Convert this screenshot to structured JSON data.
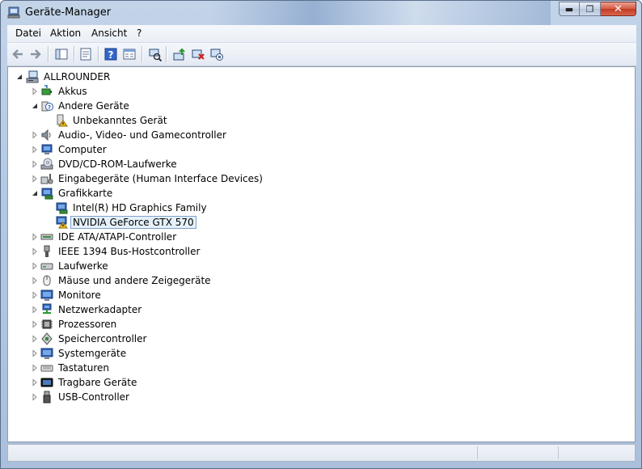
{
  "window": {
    "title": "Geräte-Manager"
  },
  "menu": [
    "Datei",
    "Aktion",
    "Ansicht",
    "?"
  ],
  "toolbar": [
    "back-icon",
    "forward-icon",
    "show-hide-tree-icon",
    "properties-icon",
    "help-icon",
    "view-icon",
    "scan-hardware-icon",
    "update-driver-icon",
    "uninstall-icon",
    "disable-icon"
  ],
  "tree": {
    "root": "ALLROUNDER",
    "items": [
      {
        "label": "Akkus",
        "icon": "battery-icon",
        "expanded": false
      },
      {
        "label": "Andere Geräte",
        "icon": "other-devices-icon",
        "expanded": true,
        "children": [
          {
            "label": "Unbekanntes Gerät",
            "icon": "unknown-device-warning-icon"
          }
        ]
      },
      {
        "label": "Audio-, Video- und Gamecontroller",
        "icon": "speaker-icon",
        "expanded": false
      },
      {
        "label": "Computer",
        "icon": "computer-icon",
        "expanded": false
      },
      {
        "label": "DVD/CD-ROM-Laufwerke",
        "icon": "dvd-drive-icon",
        "expanded": false
      },
      {
        "label": "Eingabegeräte (Human Interface Devices)",
        "icon": "hid-icon",
        "expanded": false
      },
      {
        "label": "Grafikkarte",
        "icon": "display-adapter-icon",
        "expanded": true,
        "children": [
          {
            "label": "Intel(R)  HD Graphics Family",
            "icon": "display-adapter-icon"
          },
          {
            "label": "NVIDIA GeForce GTX 570",
            "icon": "display-adapter-warning-icon",
            "selected": true
          }
        ]
      },
      {
        "label": "IDE ATA/ATAPI-Controller",
        "icon": "ide-controller-icon",
        "expanded": false
      },
      {
        "label": "IEEE 1394 Bus-Hostcontroller",
        "icon": "firewire-icon",
        "expanded": false
      },
      {
        "label": "Laufwerke",
        "icon": "disk-drive-icon",
        "expanded": false
      },
      {
        "label": "Mäuse und andere Zeigegeräte",
        "icon": "mouse-icon",
        "expanded": false
      },
      {
        "label": "Monitore",
        "icon": "monitor-icon",
        "expanded": false
      },
      {
        "label": "Netzwerkadapter",
        "icon": "network-adapter-icon",
        "expanded": false
      },
      {
        "label": "Prozessoren",
        "icon": "processor-icon",
        "expanded": false
      },
      {
        "label": "Speichercontroller",
        "icon": "storage-controller-icon",
        "expanded": false
      },
      {
        "label": "Systemgeräte",
        "icon": "system-devices-icon",
        "expanded": false
      },
      {
        "label": "Tastaturen",
        "icon": "keyboard-icon",
        "expanded": false
      },
      {
        "label": "Tragbare Geräte",
        "icon": "portable-device-icon",
        "expanded": false
      },
      {
        "label": "USB-Controller",
        "icon": "usb-icon",
        "expanded": false
      }
    ]
  },
  "colors": {
    "selection_bg": "#e5f0fb",
    "selection_border": "#7da2ce",
    "close_button": "#c8452c"
  }
}
